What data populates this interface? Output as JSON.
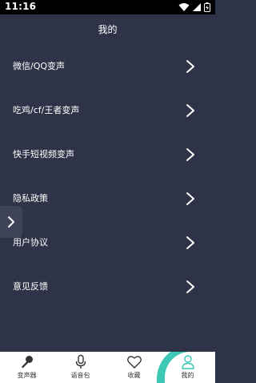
{
  "status": {
    "time": "11:16"
  },
  "header": {
    "title": "我的"
  },
  "menu": [
    {
      "label": "微信/QQ变声"
    },
    {
      "label": "吃鸡/cf/王者变声"
    },
    {
      "label": "快手短视频变声"
    },
    {
      "label": "隐私政策"
    },
    {
      "label": "用户协议"
    },
    {
      "label": "意见反馈"
    }
  ],
  "tabs": [
    {
      "label": "变声器",
      "icon": "microphone-icon"
    },
    {
      "label": "语音包",
      "icon": "voice-pack-icon"
    },
    {
      "label": "收藏",
      "icon": "heart-icon"
    },
    {
      "label": "我的",
      "icon": "user-icon",
      "active": true
    }
  ],
  "colors": {
    "background": "#2f3347",
    "accent": "#3cc8b4",
    "tabbar": "#ffffff"
  }
}
